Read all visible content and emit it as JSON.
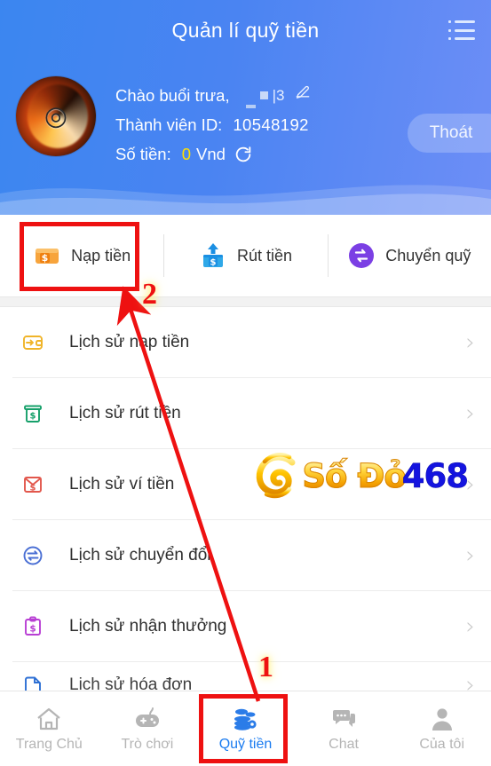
{
  "header": {
    "title": "Quản lí quỹ tiền",
    "menu_icon": "list-menu-icon",
    "greeting": "Chào buổi trưa,",
    "greeting_suffix": "|3",
    "edit_icon": "pencil-edit-icon",
    "member_label": "Thành viên ID:",
    "member_id": "10548192",
    "amount_label": "Số tiền:",
    "amount_value": "0",
    "amount_unit": "Vnd",
    "refresh_icon": "refresh-icon",
    "logout_label": "Thoát",
    "avatar_alt": "user-avatar-fire-logo",
    "gradient_start": "#3b86f0",
    "gradient_end": "#6d8ef6",
    "amount_color": "#ffe000"
  },
  "actions": [
    {
      "label": "Nạp tiền",
      "icon": "deposit-wallet-icon",
      "color": "#f5921e"
    },
    {
      "label": "Rút tiền",
      "icon": "withdraw-upload-icon",
      "color": "#2196f3"
    },
    {
      "label": "Chuyển quỹ",
      "icon": "transfer-circle-icon",
      "color": "#7b3fe4"
    }
  ],
  "list_items": [
    {
      "label": "Lịch sử nạp tiền",
      "icon": "wallet-arrow-icon",
      "color": "#f0b429",
      "partial": false
    },
    {
      "label": "Lịch sử rút tiền",
      "icon": "atm-dollar-icon",
      "color": "#16a06a",
      "partial": false
    },
    {
      "label": "Lịch sử ví tiền",
      "icon": "envelope-dollar-icon",
      "color": "#e2574c",
      "partial": false
    },
    {
      "label": "Lịch sử chuyển đổi",
      "icon": "exchange-circle-icon",
      "color": "#4a6fd4",
      "partial": false
    },
    {
      "label": "Lịch sử nhận thưởng",
      "icon": "clipboard-dollar-icon",
      "color": "#b83fd4",
      "partial": false
    },
    {
      "label": "Lịch sử hóa đơn",
      "icon": "document-icon",
      "color": "#2d6fd4",
      "partial": true
    }
  ],
  "watermark": {
    "text_primary": "Số Đỏ",
    "text_secondary": "468",
    "swirl_icon": "spiral-swirl-logo",
    "primary_color": "#ffc400",
    "secondary_color": "#1414e0"
  },
  "bottom_nav": [
    {
      "label": "Trang Chủ",
      "icon": "home-icon",
      "active": false
    },
    {
      "label": "Trò chơi",
      "icon": "gamepad-icon",
      "active": false
    },
    {
      "label": "Quỹ tiền",
      "icon": "coins-gear-icon",
      "active": true
    },
    {
      "label": "Chat",
      "icon": "chat-bubble-icon",
      "active": false
    },
    {
      "label": "Của tôi",
      "icon": "user-person-icon",
      "active": false
    }
  ],
  "annotations": {
    "step_one": "1",
    "step_two": "2",
    "highlight_color": "#ee1111"
  },
  "chevron": "›"
}
